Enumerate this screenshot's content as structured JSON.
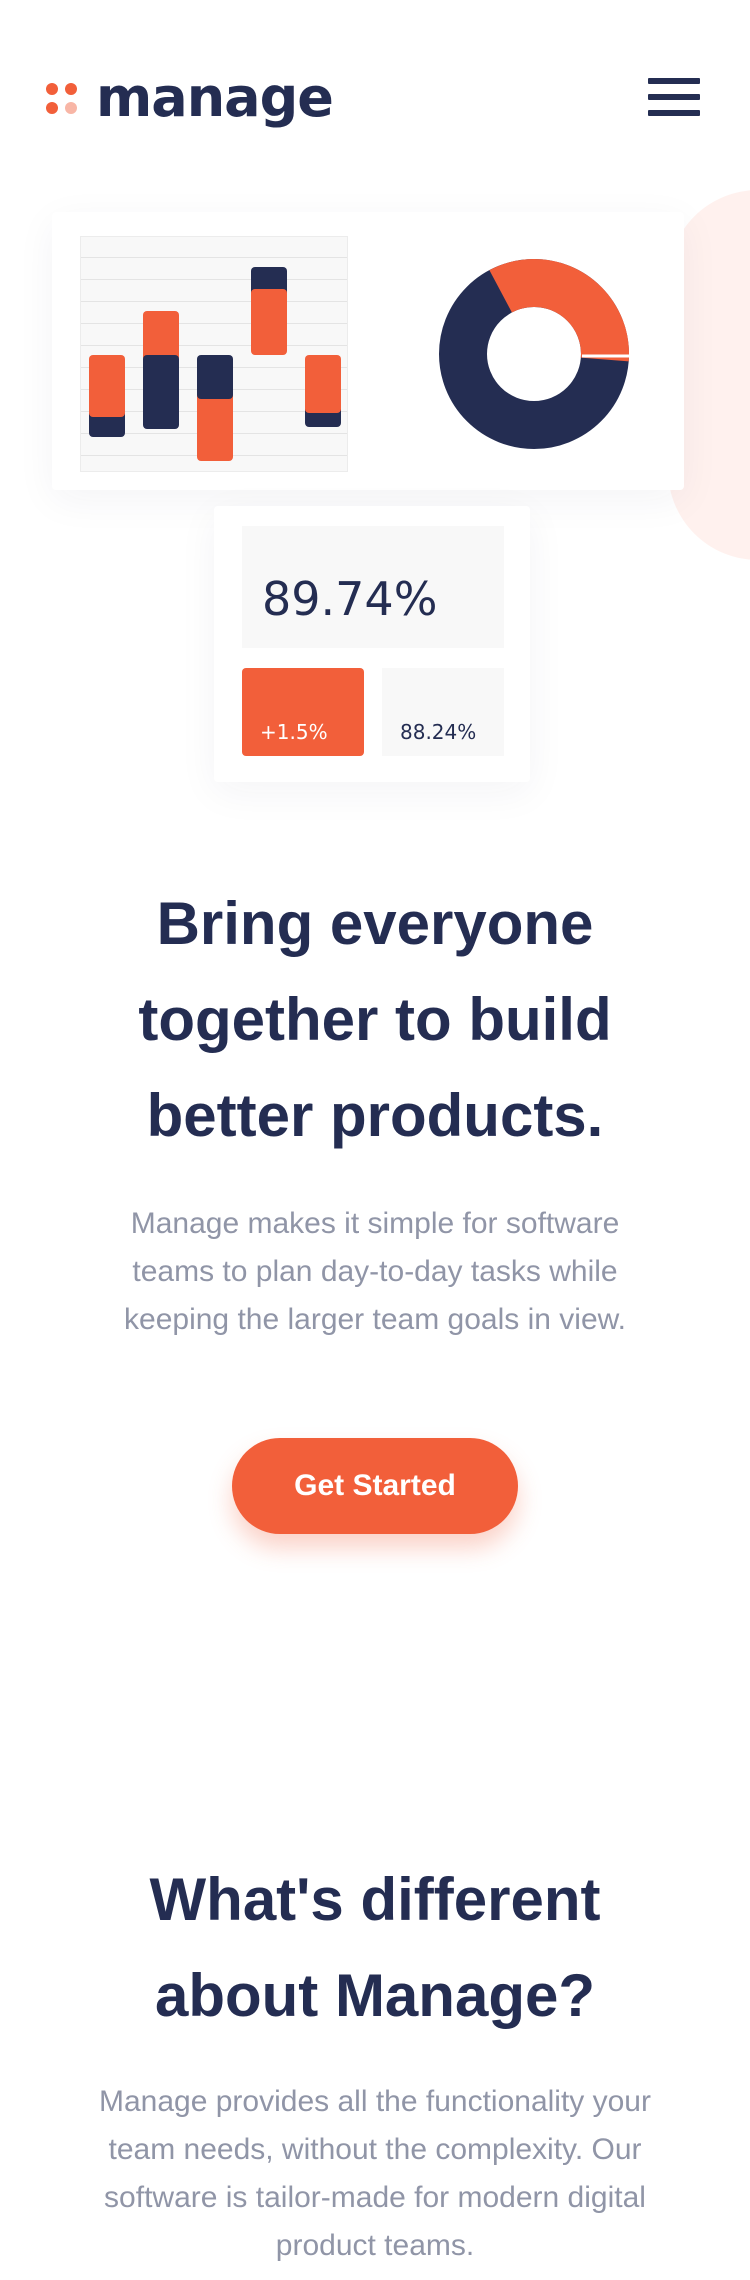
{
  "brand": {
    "name": "manage",
    "accent_color": "#f25f3a",
    "accent_light": "#f8b6a6",
    "navy_color": "#242d52",
    "muted_text_color": "#9095a7"
  },
  "header": {
    "menu_icon": "hamburger-menu-icon"
  },
  "illustration": {
    "bar_chart": {
      "icon": "bar-chart-illustration"
    },
    "donut_chart": {
      "icon": "donut-chart-illustration",
      "orange_fraction": 0.34
    },
    "stats": {
      "main_value": "89.74%",
      "change_value": "+1.5%",
      "secondary_value": "88.24%"
    }
  },
  "hero": {
    "title_lines": [
      "Bring everyone",
      "together to build",
      "better products."
    ],
    "description": "Manage makes it simple for software teams to plan day-to-day tasks while keeping the larger team goals in view.",
    "cta_label": "Get Started"
  },
  "features": {
    "title_lines": [
      "What's different",
      "about Manage?"
    ],
    "description": "Manage provides all the functionality your team needs, without the complexity. Our software is tailor-made for modern digital product teams."
  }
}
